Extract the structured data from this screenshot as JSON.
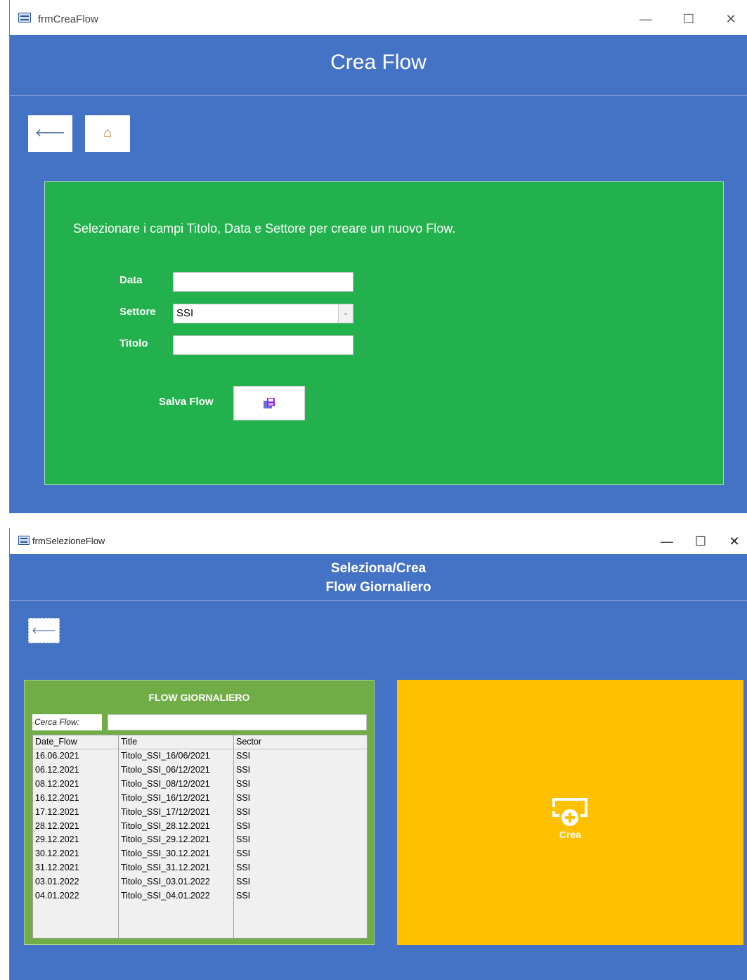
{
  "window1": {
    "title": "frmCreaFlow",
    "controls": {
      "minimize": "—",
      "maximize": "☐",
      "close": "✕"
    },
    "header": "Crea Flow",
    "nav": {
      "back": "🡐",
      "home": "⌂"
    },
    "form": {
      "intro": "Selezionare i campi Titolo, Data e Settore per creare un nuovo Flow.",
      "data_label": "Data",
      "data_value": "",
      "settore_label": "Settore",
      "settore_value": "SSI",
      "titolo_label": "Titolo",
      "titolo_value": "",
      "save_label": "Salva Flow"
    }
  },
  "window2": {
    "title": "frmSelezioneFlow",
    "controls": {
      "minimize": "—",
      "maximize": "☐",
      "close": "✕"
    },
    "header": {
      "line1": "Seleziona/Crea",
      "line2": "Flow Giornaliero"
    },
    "nav": {
      "back": "🡐"
    },
    "list": {
      "title": "FLOW GIORNALIERO",
      "search_label": "Cerca Flow:",
      "search_value": "",
      "headers": [
        "Date_Flow",
        "Title",
        "Sector"
      ],
      "rows": [
        [
          "16.06.2021",
          "Titolo_SSI_16/06/2021",
          "SSI"
        ],
        [
          "06.12.2021",
          "Titolo_SSI_06/12/2021",
          "SSI"
        ],
        [
          "08.12.2021",
          "Titolo_SSI_08/12/2021",
          "SSI"
        ],
        [
          "16.12.2021",
          "Titolo_SSI_16/12/2021",
          "SSI"
        ],
        [
          "17.12.2021",
          "Titolo_SSI_17/12/2021",
          "SSI"
        ],
        [
          "28.12.2021",
          "Titolo_SSI_28.12.2021",
          "SSI"
        ],
        [
          "29.12.2021",
          "Titolo_SSI_29.12.2021",
          "SSI"
        ],
        [
          "30.12.2021",
          "Titolo_SSI_30.12.2021",
          "SSI"
        ],
        [
          "31.12.2021",
          "Titolo_SSI_31.12.2021",
          "SSI"
        ],
        [
          "03.01.2022",
          "Titolo_SSI_03.01.2022",
          "SSI"
        ],
        [
          "04.01.2022",
          "Titolo_SSI_04.01.2022",
          "SSI"
        ]
      ]
    },
    "crea_label": "Crea"
  },
  "colors": {
    "form_blue": "#4472c4",
    "panel_green": "#22b14c",
    "list_green": "#70ad47",
    "crea_yellow": "#ffc000"
  },
  "icons": {
    "back": "arrow-left-icon",
    "home": "home-icon",
    "save": "save-icon",
    "create": "add-screen-icon"
  }
}
